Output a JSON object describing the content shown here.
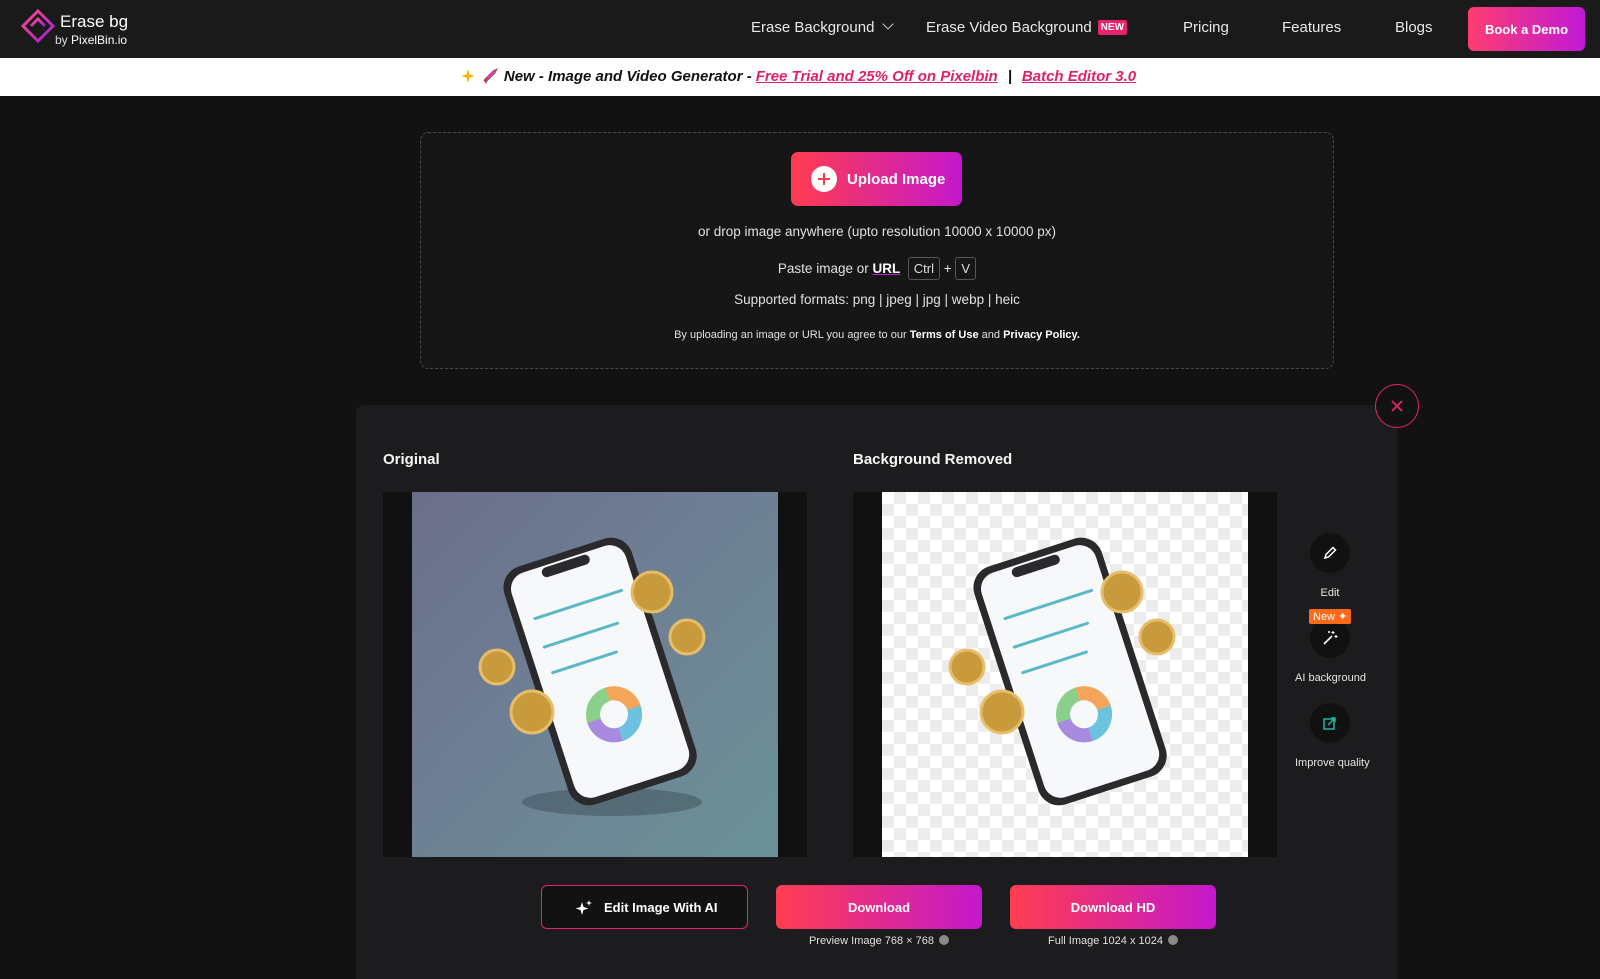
{
  "nav": {
    "logo_title": "Erase bg",
    "logo_by": "by",
    "logo_brand": "PixelBin.io",
    "items": [
      {
        "label": "Erase Background"
      },
      {
        "label": "Erase Video Background",
        "badge": "NEW"
      },
      {
        "label": "Pricing"
      },
      {
        "label": "Features"
      },
      {
        "label": "Blogs"
      }
    ],
    "cta": "Book a Demo"
  },
  "banner": {
    "text": "New - Image and Video Generator -",
    "link1": "Free Trial and 25% Off on Pixelbin",
    "separator": "|",
    "link2": "Batch Editor 3.0"
  },
  "upload": {
    "button": "Upload Image",
    "drop_text": "or drop image anywhere (upto resolution 10000 x 10000 px)",
    "paste_prefix": "Paste image or",
    "paste_link": "URL",
    "key1": "Ctrl",
    "plus": "+",
    "key2": "V",
    "formats_label": "Supported formats:",
    "formats": "png | jpeg | jpg | webp | heic",
    "terms_prefix": "By uploading an image or URL you agree to our",
    "terms_link": "Terms of Use",
    "terms_and": "and",
    "privacy_link": "Privacy Policy."
  },
  "result": {
    "original_title": "Original",
    "removed_title": "Background Removed",
    "tools": [
      {
        "label": "Edit",
        "icon": "pencil-icon"
      },
      {
        "label": "AI background",
        "icon": "magic-wand-icon",
        "badge": "New"
      },
      {
        "label": "Improve quality",
        "icon": "enhance-icon"
      }
    ],
    "edit_ai_button": "Edit Image With AI",
    "download_button": "Download",
    "download_hd_button": "Download HD",
    "preview_note": "Preview Image 768 × 768",
    "full_note": "Full Image 1024 x 1024"
  },
  "colors": {
    "accent_pink": "#e8236b",
    "gradient_start": "#ff3d50",
    "gradient_end": "#c418cc",
    "new_badge_orange": "#ff6a1a"
  }
}
